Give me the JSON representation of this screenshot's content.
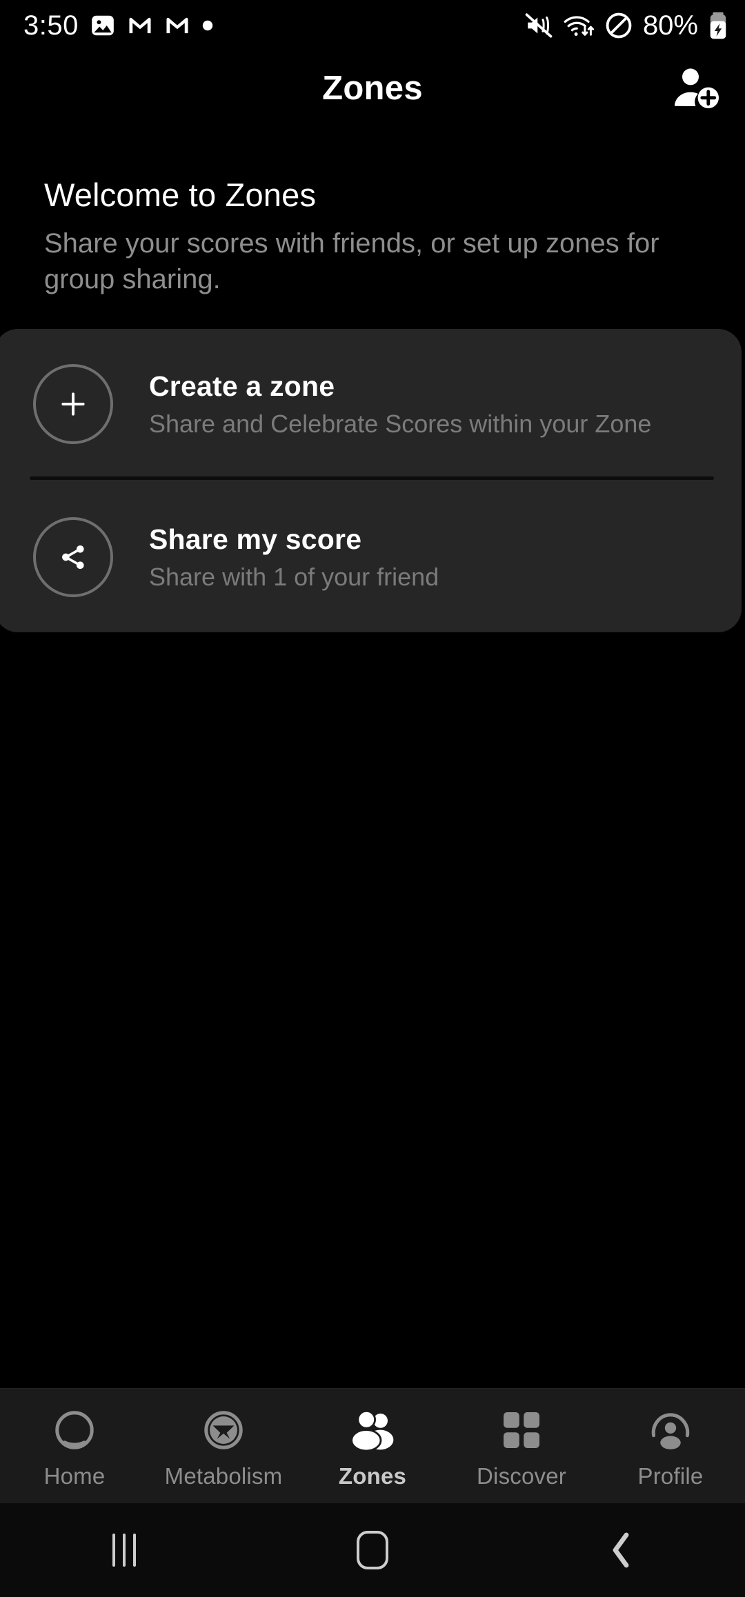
{
  "status_bar": {
    "clock": "3:50",
    "battery_text": "80%",
    "left_icons": [
      "photos-icon",
      "gmail-icon",
      "gmail-icon",
      "dot-icon"
    ],
    "right_icons": [
      "mute-icon",
      "wifi-data-icon",
      "do-not-disturb-icon",
      "battery-charging-icon"
    ]
  },
  "header": {
    "title": "Zones",
    "action_icon": "add-person-icon"
  },
  "welcome": {
    "heading": "Welcome to Zones",
    "subtitle": "Share your scores with friends, or set up zones for group sharing."
  },
  "actions": [
    {
      "icon": "plus-icon",
      "title": "Create a zone",
      "subtitle": "Share and Celebrate Scores within your Zone"
    },
    {
      "icon": "share-icon",
      "title": "Share my score",
      "subtitle": "Share with 1 of your friend"
    }
  ],
  "bottom_nav": {
    "active": "Zones",
    "items": [
      {
        "label": "Home",
        "icon": "ring-icon"
      },
      {
        "label": "Metabolism",
        "icon": "metabolism-crown-icon"
      },
      {
        "label": "Zones",
        "icon": "people-group-icon"
      },
      {
        "label": "Discover",
        "icon": "grid-squares-icon"
      },
      {
        "label": "Profile",
        "icon": "person-circle-icon"
      }
    ]
  },
  "system_nav": {
    "items": [
      {
        "label": "Recents",
        "icon": "recents-icon"
      },
      {
        "label": "Home",
        "icon": "home-icon"
      },
      {
        "label": "Back",
        "icon": "back-chevron-icon"
      }
    ]
  },
  "colors": {
    "background": "#000000",
    "card": "#272626",
    "nav_bar": "#1c1b1b",
    "system_nav": "#0b0b0b",
    "primary_text": "#ffffff",
    "secondary_text": "#8e8e8e",
    "icon_outline": "#6f6f6f",
    "nav_inactive": "#8e8d8d"
  }
}
